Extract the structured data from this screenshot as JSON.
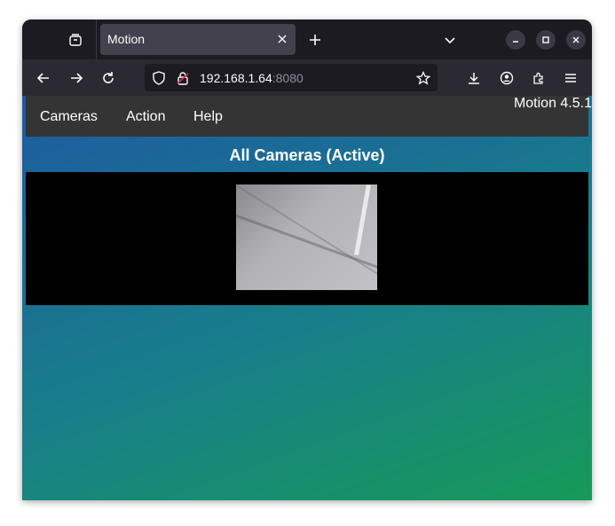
{
  "browser": {
    "tab_title": "Motion",
    "url_host": "192.168.1.64",
    "url_port": ":8080"
  },
  "page": {
    "menu": [
      "Cameras",
      "Action",
      "Help"
    ],
    "version": "Motion 4.5.1",
    "heading": "All Cameras (Active)"
  },
  "colors": {
    "menubar": "#343434",
    "gradient_start": "#1d5aa0",
    "gradient_end": "#169a58",
    "camera_panel": "#000000"
  },
  "icons": [
    "tab-overview-icon",
    "close-icon",
    "plus-icon",
    "chevron-down-icon",
    "minimize-icon",
    "maximize-icon",
    "back-icon",
    "forward-icon",
    "reload-icon",
    "shield-icon",
    "insecure-lock-icon",
    "star-icon",
    "download-icon",
    "account-icon",
    "extensions-icon",
    "menu-icon"
  ]
}
